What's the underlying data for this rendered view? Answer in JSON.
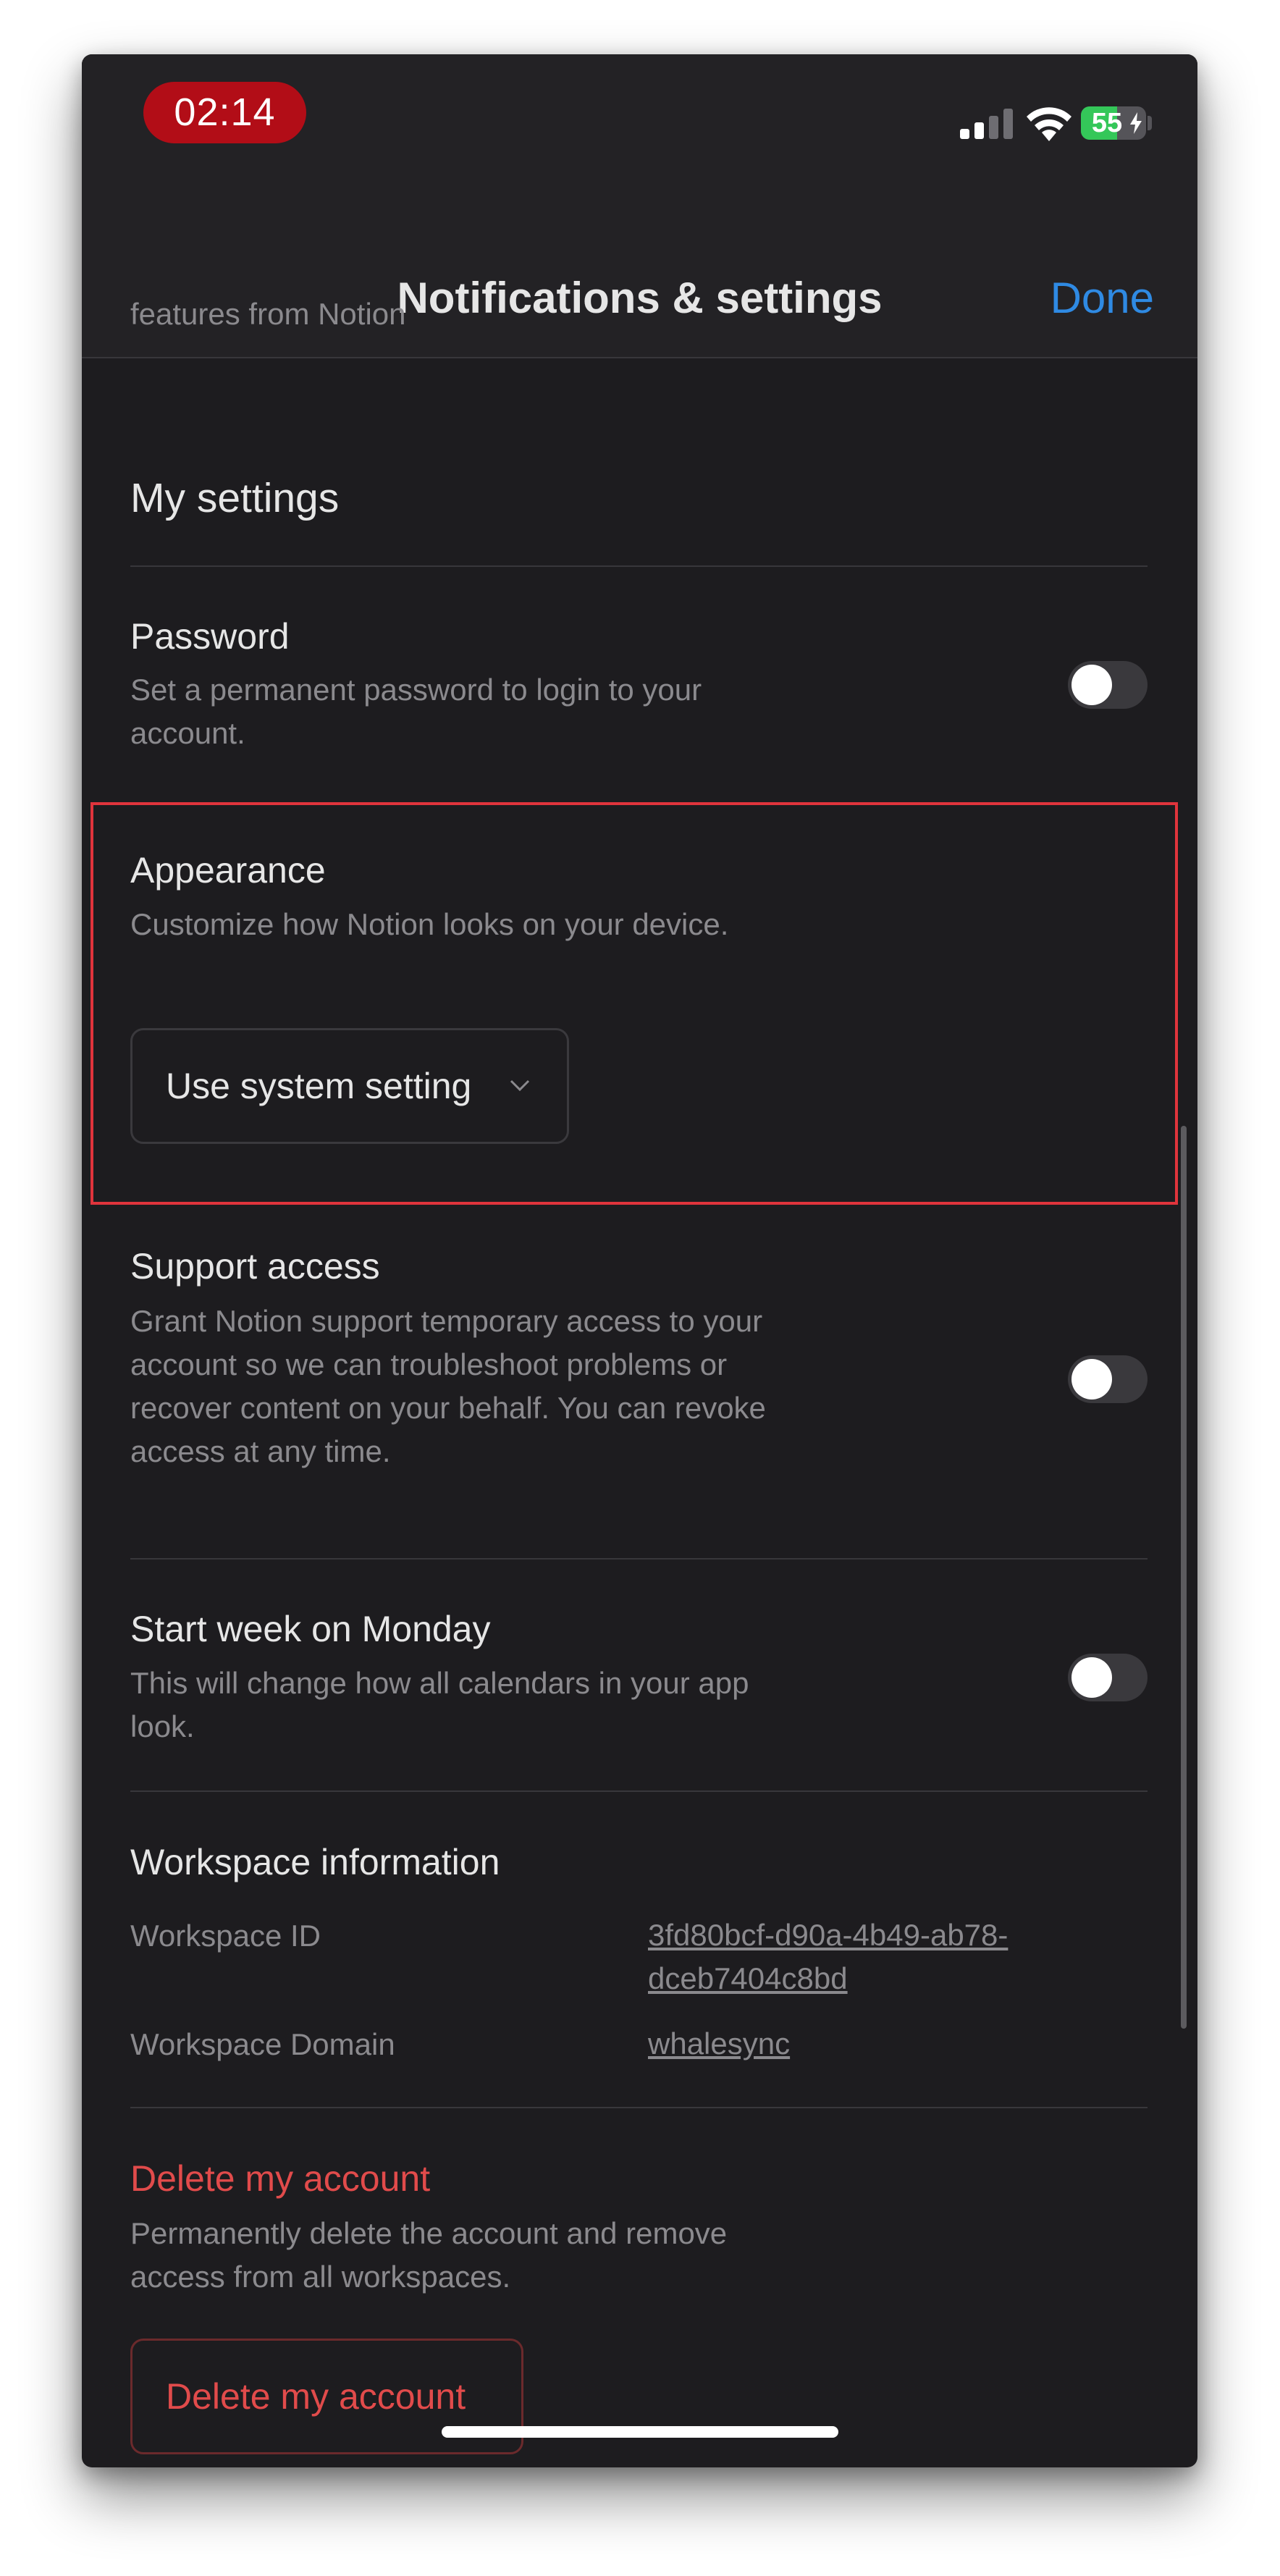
{
  "status_bar": {
    "time": "02:14",
    "battery_level": "55",
    "battery_fraction": 0.55,
    "signal_icon": "cellular-signal-icon",
    "wifi_icon": "wifi-icon"
  },
  "nav": {
    "title": "Notifications & settings",
    "done_label": "Done"
  },
  "truncated_text": "features from Notion",
  "my_settings": {
    "heading": "My settings",
    "password": {
      "title": "Password",
      "description": "Set a permanent password to login to your account.",
      "enabled": false
    },
    "appearance": {
      "title": "Appearance",
      "description": "Customize how Notion looks on your device.",
      "selected": "Use system setting"
    },
    "support_access": {
      "title": "Support access",
      "description": "Grant Notion support temporary access to your account so we can troubleshoot problems or recover content on your behalf. You can revoke access at any time.",
      "enabled": false
    },
    "start_week": {
      "title": "Start week on Monday",
      "description": "This will change how all calendars in your app look.",
      "enabled": false
    }
  },
  "workspace": {
    "heading": "Workspace information",
    "id_label": "Workspace ID",
    "id_value": "3fd80bcf-d90a-4b49-ab78-dceb7404c8bd",
    "domain_label": "Workspace Domain",
    "domain_value": "whalesync"
  },
  "delete_account": {
    "title": "Delete my account",
    "description": "Permanently delete the account and remove access from all workspaces.",
    "button_label": "Delete my account"
  },
  "colors": {
    "accent": "#2f8ae3",
    "danger": "#e14b4b",
    "highlight": "#e0343c",
    "time_pill": "#b20d17",
    "battery": "#34c759"
  }
}
